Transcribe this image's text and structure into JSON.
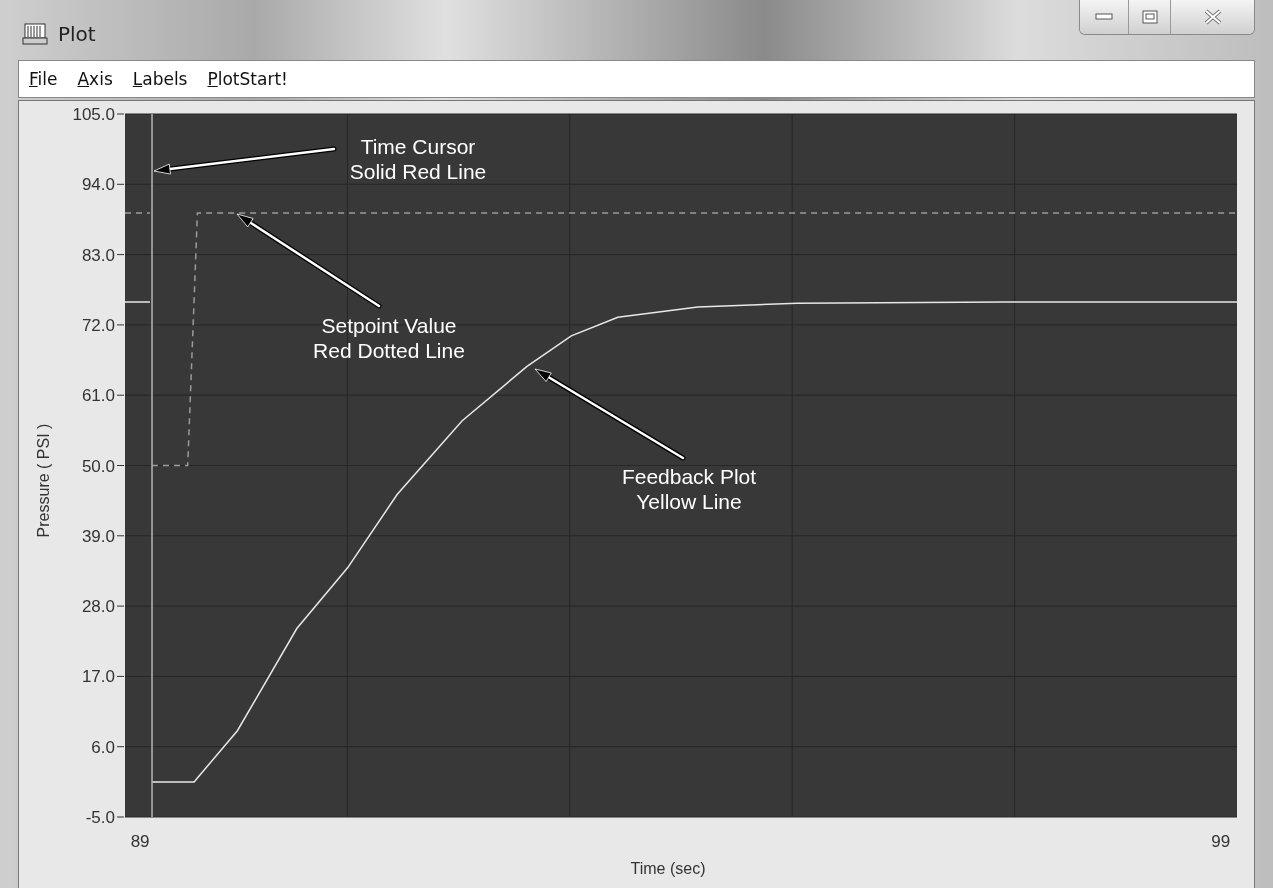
{
  "window": {
    "title": "Plot"
  },
  "menu": [
    {
      "label": "File"
    },
    {
      "label": "Axis"
    },
    {
      "label": "Labels"
    },
    {
      "label": "PlotStart!"
    }
  ],
  "plot": {
    "chart_data": {
      "type": "line",
      "xlabel": "Time (sec)",
      "ylabel": "Pressure ( PSI )",
      "xlim": [
        88.86,
        99.15
      ],
      "ylim": [
        -5,
        105
      ],
      "grid": true,
      "xticks": [
        {
          "value": 89,
          "label": "89"
        },
        {
          "value": 99,
          "label": "99"
        }
      ],
      "yticks": [
        {
          "value": 105,
          "label": "105.0"
        },
        {
          "value": 94,
          "label": "94.0"
        },
        {
          "value": 83,
          "label": "83.0"
        },
        {
          "value": 72,
          "label": "72.0"
        },
        {
          "value": 61,
          "label": "61.0"
        },
        {
          "value": 50,
          "label": "50.0"
        },
        {
          "value": 39,
          "label": "39.0"
        },
        {
          "value": 28,
          "label": "28.0"
        },
        {
          "value": 17,
          "label": "17.0"
        },
        {
          "value": 6,
          "label": "6.0"
        },
        {
          "value": -5,
          "label": "-5.0"
        }
      ],
      "x": [
        88.86,
        89.09,
        89.1,
        89.11,
        89.44,
        89.5,
        89.53,
        89.9,
        90.45,
        90.92,
        91.38,
        91.98,
        92.58,
        92.99,
        93.42,
        94.16,
        95.08,
        97,
        99.15
      ],
      "series": [
        {
          "color": "#9a9a9a",
          "line_style": "dashed",
          "values": [
            89.5,
            89.5,
            null,
            50,
            50,
            76.3,
            89.5,
            89.5,
            89.5,
            89.5,
            89.5,
            89.5,
            89.5,
            89.5,
            89.5,
            89.5,
            89.5,
            89.5,
            89.5
          ]
        },
        {
          "color": "#e8e8e8",
          "line_style": "solid",
          "values": [
            75.6,
            75.6,
            null,
            0.5,
            0.5,
            0.5,
            1.1,
            8.5,
            24.5,
            34,
            45.5,
            57,
            65.5,
            70.3,
            73.2,
            74.8,
            75.4,
            75.6,
            75.6
          ]
        }
      ],
      "ref_lines": [
        {
          "axis": "x",
          "value": 89.11,
          "color": "#b5b5b5"
        }
      ]
    },
    "callouts": [
      {
        "lines": [
          "Time Cursor",
          "Solid Red Line"
        ]
      },
      {
        "lines": [
          "Setpoint Value",
          "Red Dotted Line"
        ]
      },
      {
        "lines": [
          "Feedback Plot",
          "Yellow Line"
        ]
      }
    ]
  }
}
